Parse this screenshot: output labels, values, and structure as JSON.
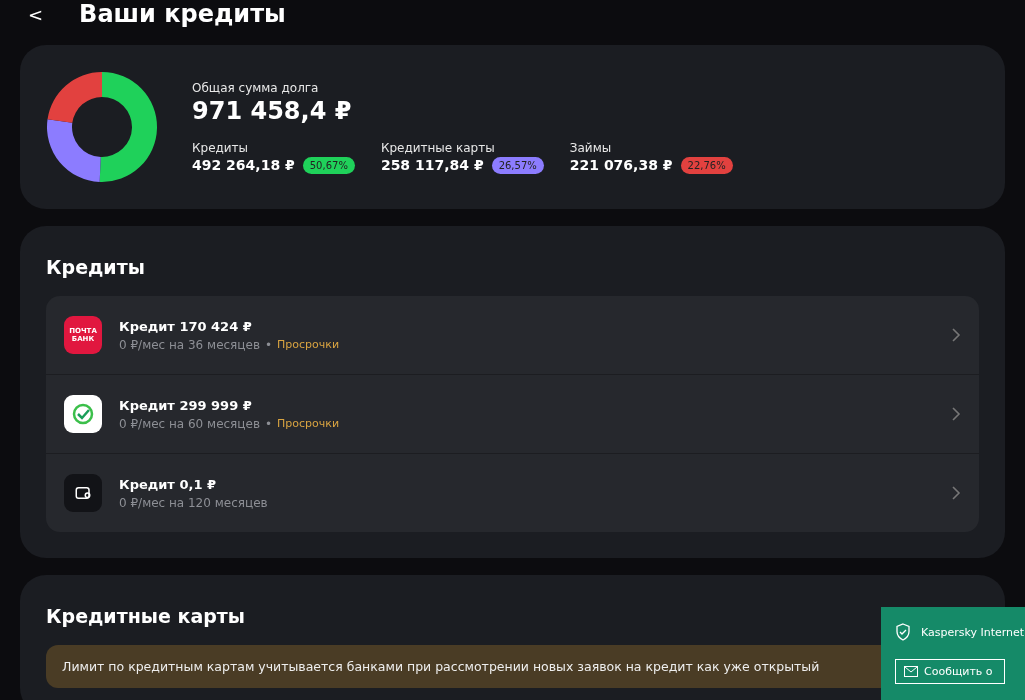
{
  "header": {
    "back": "<",
    "title": "Ваши кредиты"
  },
  "summary": {
    "label": "Общая сумма долга",
    "total": "971 458,4 ₽",
    "chart_data": {
      "type": "donut",
      "categories": [
        "Кредиты",
        "Кредитные карты",
        "Займы"
      ],
      "values": [
        50.67,
        26.57,
        22.76
      ],
      "colors": [
        "#1fd15a",
        "#8c7cff",
        "#e2413f"
      ]
    },
    "parts": [
      {
        "amount": "492 264,18 ₽",
        "percent": "50,67%",
        "color": "#1fd15a"
      },
      {
        "amount": "258 117,84 ₽",
        "percent": "26,57%",
        "color": "#8c7cff"
      },
      {
        "amount": "221 076,38 ₽",
        "percent": "22,76%",
        "color": "#e2413f"
      }
    ]
  },
  "credits": {
    "title": "Кредиты",
    "items": [
      {
        "kind": "post",
        "logo_text": "ПОЧТА БАНК",
        "title": "Кредит 170 424 ₽",
        "terms": "0 ₽/мес на 36 месяцев",
        "separator": "•",
        "overdue": "Просрочки"
      },
      {
        "kind": "check",
        "title": "Кредит 299 999 ₽",
        "terms": "0 ₽/мес на 60 месяцев",
        "separator": "•",
        "overdue": "Просрочки"
      },
      {
        "kind": "wallet",
        "title": "Кредит 0,1 ₽",
        "terms": "0 ₽/мес на 120 месяцев"
      }
    ]
  },
  "cards": {
    "title": "Кредитные карты",
    "notice": "Лимит по кредитным картам учитывается банками при рассмотрении новых заявок на кредит как уже открытый"
  },
  "popup": {
    "title": "Kaspersky Internet",
    "button": "Сообщить о"
  }
}
